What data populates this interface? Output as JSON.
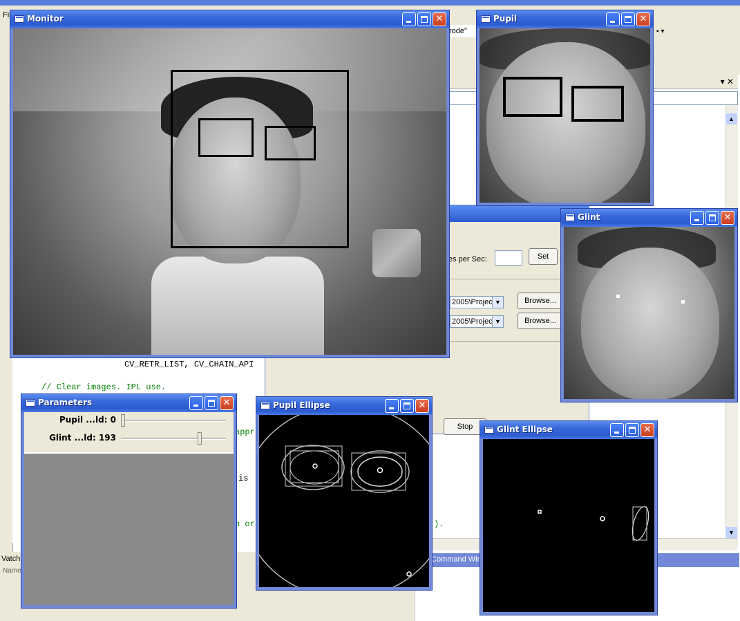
{
  "ide": {
    "menu_fragment": "Fil",
    "combo_text": "rode\"",
    "code_lines": [
      "CV_RETR_LIST, CV_CHAIN_API",
      "// Clear images. IPL use.",
      "appr",
      "is",
      "n or",
      ")."
    ],
    "dialog": {
      "fps_label": "es per Sec:",
      "fps_value": "",
      "set_button": "Set",
      "path1": "2005\\Projec",
      "path2": "2005\\Projec",
      "browse1": "Browse...",
      "browse2": "Browse...",
      "stop_button": "Stop"
    },
    "watch_tab": "Vatch",
    "name_col": "Name",
    "command_window": "Command Wind",
    "panel_close": "▾ ✕"
  },
  "windows": {
    "monitor": {
      "title": "Monitor"
    },
    "pupil": {
      "title": "Pupil"
    },
    "glint": {
      "title": "Glint"
    },
    "parameters": {
      "title": "Parameters",
      "sliders": [
        {
          "label": "Pupil ...ld: 0",
          "value": 0,
          "max": 255
        },
        {
          "label": "Glint ...ld: 193",
          "value": 193,
          "max": 255
        }
      ]
    },
    "pupil_ellipse": {
      "title": "Pupil Ellipse"
    },
    "glint_ellipse": {
      "title": "Glint Ellipse"
    }
  },
  "colors": {
    "titlebar": "#2c5ccf",
    "accent": "#7189d6",
    "close": "#c83f1f"
  }
}
